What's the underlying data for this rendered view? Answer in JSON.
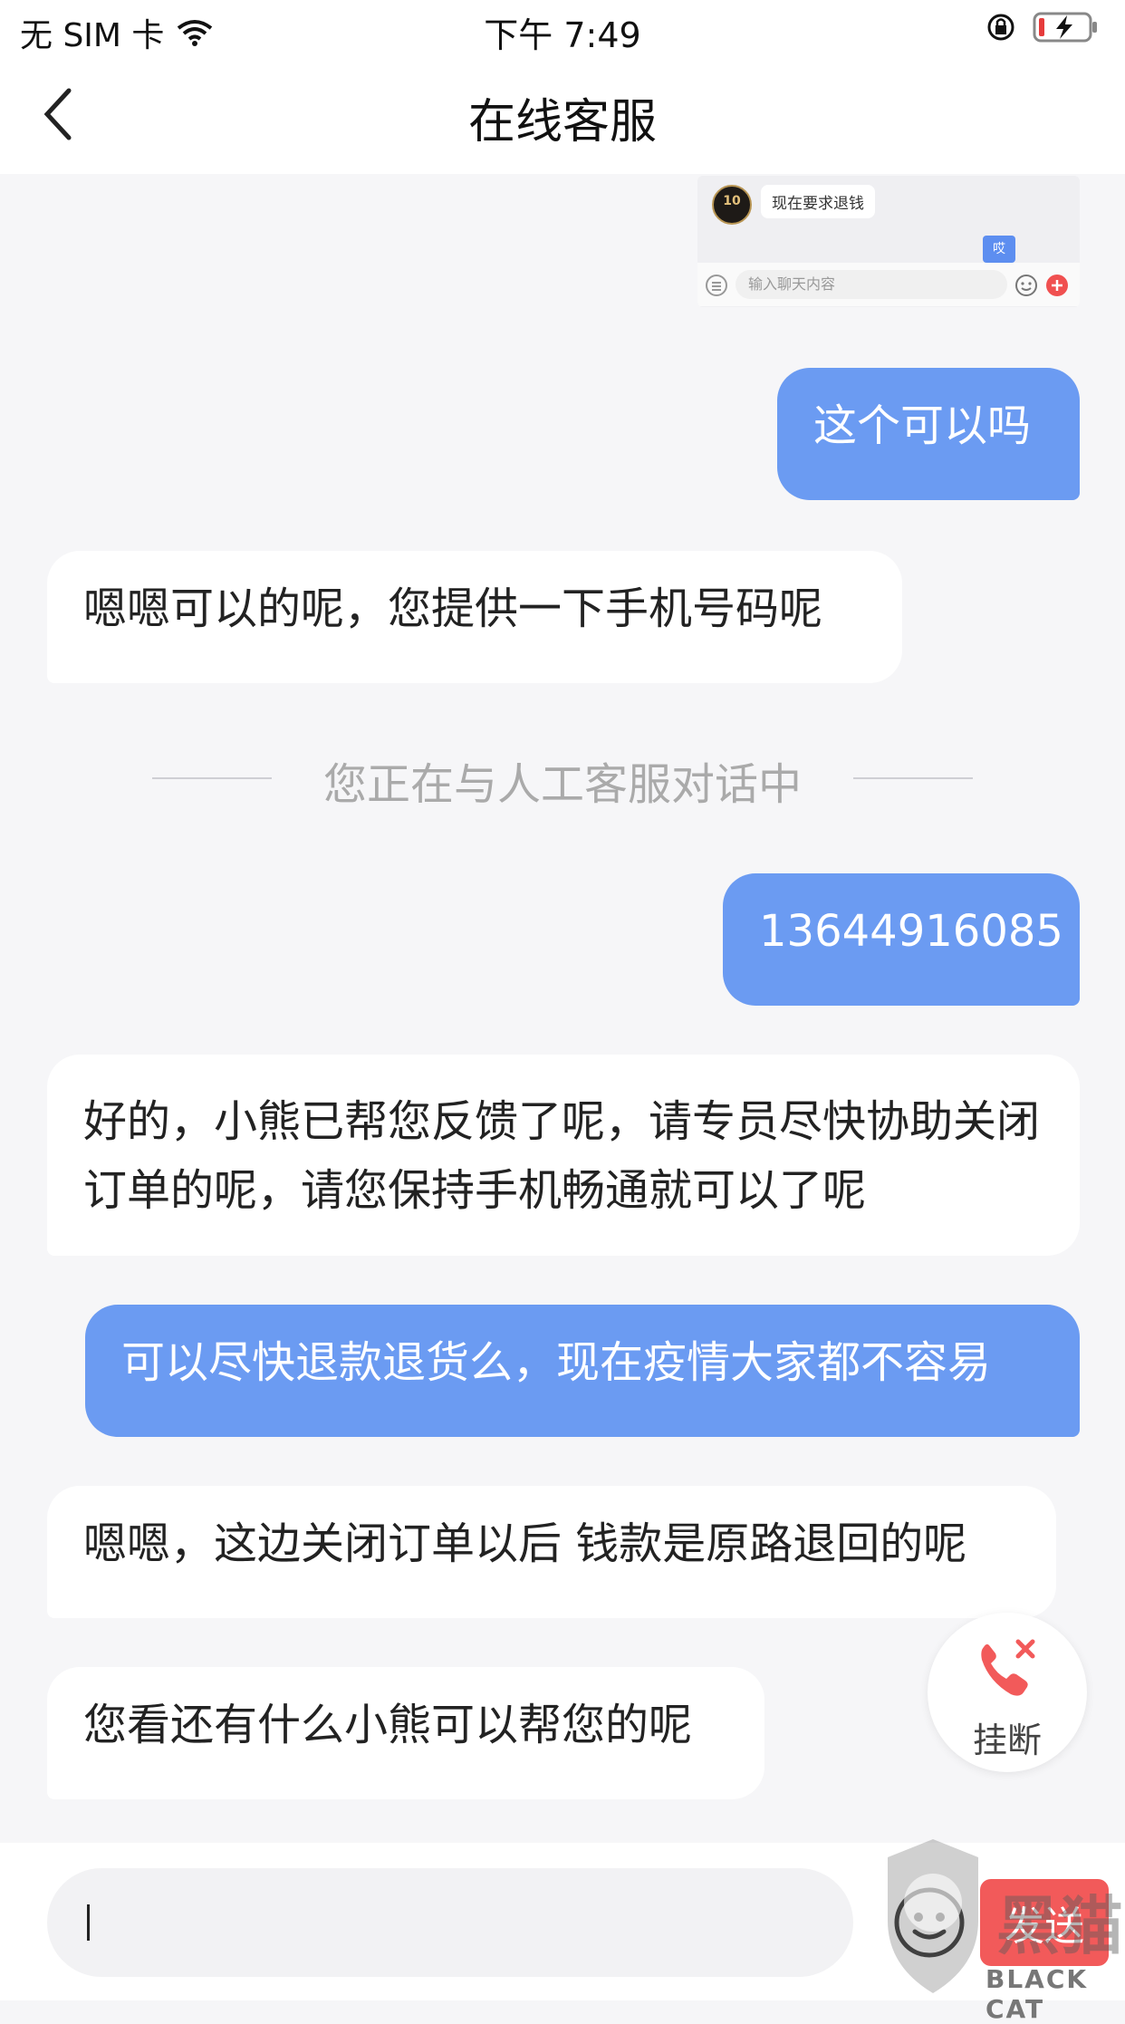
{
  "status_bar": {
    "carrier": "无 SIM 卡",
    "time": "下午 7:49"
  },
  "nav": {
    "title": "在线客服"
  },
  "attachment": {
    "avatar_badge": "10",
    "bubble_text": "现在要求退钱",
    "blue_text": "哎",
    "input_placeholder": "输入聊天内容"
  },
  "messages": [
    {
      "side": "out",
      "text": "这个可以吗"
    },
    {
      "side": "in",
      "text": "嗯嗯可以的呢，您提供一下手机号码呢"
    },
    {
      "side": "out",
      "text": "13644916085"
    },
    {
      "side": "in",
      "text": "好的，小熊已帮您反馈了呢，请专员尽快协助关闭订单的呢，请您保持手机畅通就可以了呢"
    },
    {
      "side": "out",
      "text": "可以尽快退款退货么，现在疫情大家都不容易"
    },
    {
      "side": "in",
      "text": "嗯嗯，这边关闭订单以后 钱款是原路退回的呢"
    },
    {
      "side": "in",
      "text": "您看还有什么小熊可以帮您的呢"
    }
  ],
  "divider": {
    "text": "您正在与人工客服对话中"
  },
  "hangup": {
    "label": "挂断",
    "accent": "#f25a5a"
  },
  "composer": {
    "value": "",
    "send_label": "发送"
  },
  "watermark": {
    "brand": "黑猫",
    "text": "BLACK CAT"
  },
  "colors": {
    "outgoing_bubble": "#6b9bf2",
    "background": "#f6f6f8",
    "send_button": "#f25a5a"
  }
}
